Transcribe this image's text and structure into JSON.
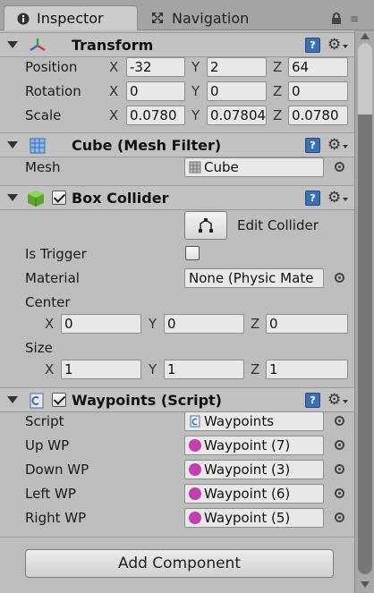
{
  "tabs": {
    "inspector": "Inspector",
    "navigation": "Navigation"
  },
  "transform": {
    "title": "Transform",
    "position_label": "Position",
    "rotation_label": "Rotation",
    "scale_label": "Scale",
    "axis_x": "X",
    "axis_y": "Y",
    "axis_z": "Z",
    "position": {
      "x": "-32",
      "y": "2",
      "z": "64"
    },
    "rotation": {
      "x": "0",
      "y": "0",
      "z": "0"
    },
    "scale": {
      "x": "0.0780",
      "y": "0.07804",
      "z": "0.0780"
    }
  },
  "mesh_filter": {
    "title": "Cube (Mesh Filter)",
    "mesh_label": "Mesh",
    "mesh_value": "Cube"
  },
  "box_collider": {
    "title": "Box Collider",
    "enabled": true,
    "edit_collider_label": "Edit Collider",
    "is_trigger_label": "Is Trigger",
    "is_trigger": false,
    "material_label": "Material",
    "material_value": "None (Physic Mate",
    "center_label": "Center",
    "center": {
      "x": "0",
      "y": "0",
      "z": "0"
    },
    "size_label": "Size",
    "size": {
      "x": "1",
      "y": "1",
      "z": "1"
    }
  },
  "waypoints": {
    "title": "Waypoints (Script)",
    "enabled": true,
    "script_label": "Script",
    "script_value": "Waypoints",
    "up_label": "Up WP",
    "up_value": "Waypoint (7)",
    "down_label": "Down WP",
    "down_value": "Waypoint (3)",
    "left_label": "Left WP",
    "left_value": "Waypoint (6)",
    "right_label": "Right WP",
    "right_value": "Waypoint (5)"
  },
  "add_component_label": "Add Component",
  "colors": {
    "panel_bg": "#bdbdbd",
    "help_icon": "#3e6fb2",
    "waypoint_icon": "#c23fae",
    "collider_icon": "#5aa62a"
  },
  "icons": [
    "info-icon",
    "navigation-icon",
    "lock-icon",
    "transform-axes-icon",
    "mesh-filter-icon",
    "box-collider-icon",
    "script-icon",
    "help-icon",
    "gear-icon",
    "object-picker-icon"
  ]
}
